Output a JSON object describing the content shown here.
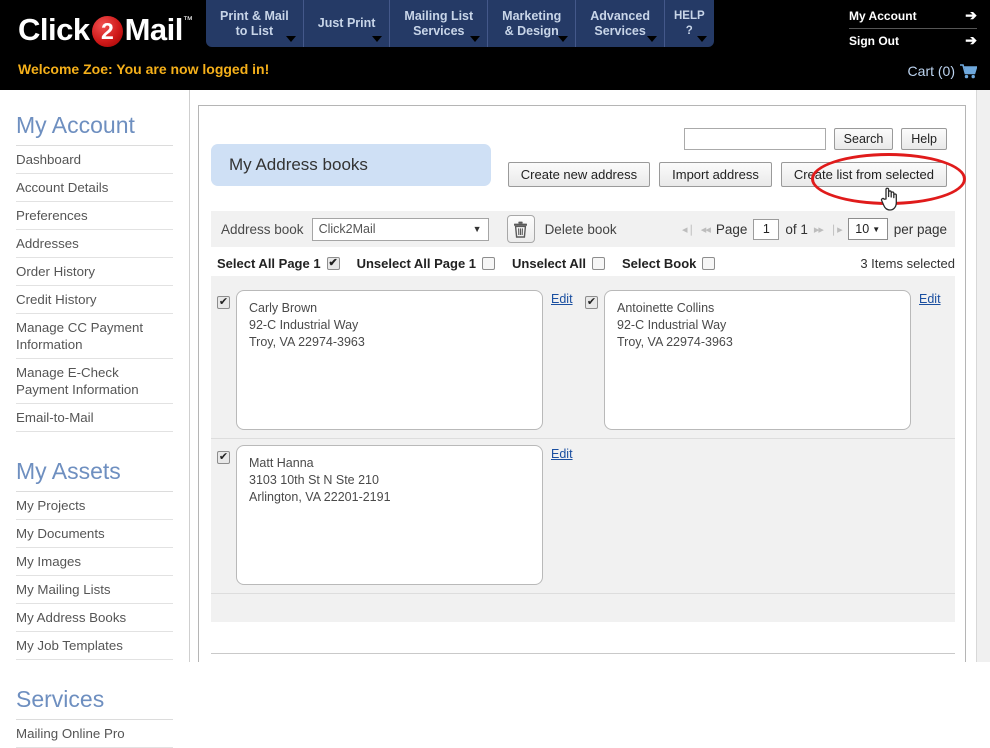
{
  "brand": {
    "name_part1": "Click",
    "name_badge": "2",
    "name_part2": "Mail",
    "trademark": "™",
    "accent_red": "#d01a1a",
    "nav_blue": "#253a66"
  },
  "topbar": {
    "welcome": "Welcome Zoe: You are now logged in!",
    "cart_label": "Cart (0)",
    "cart_icon": "shopping-cart-icon",
    "account_links": [
      {
        "label": "My Account",
        "arrow": "➔"
      },
      {
        "label": "Sign Out",
        "arrow": "➔"
      }
    ]
  },
  "nav": {
    "items": [
      {
        "label": "Print & Mail\nto List",
        "has_caret": true
      },
      {
        "label": "Just Print",
        "has_caret": true
      },
      {
        "label": "Mailing List\nServices",
        "has_caret": true
      },
      {
        "label": "Marketing\n& Design",
        "has_caret": true
      },
      {
        "label": "Advanced\nServices",
        "has_caret": true
      },
      {
        "label": "HELP\n?",
        "has_caret": true
      }
    ]
  },
  "sidebar": {
    "groups": [
      {
        "heading": "My Account",
        "items": [
          "Dashboard",
          "Account Details",
          "Preferences",
          "Addresses",
          "Order History",
          "Credit History",
          "Manage CC Payment Information",
          "Manage E-Check Payment Information",
          "Email-to-Mail"
        ]
      },
      {
        "heading": "My Assets",
        "items": [
          "My Projects",
          "My Documents",
          "My Images",
          "My Mailing Lists",
          "My Address Books",
          "My Job Templates"
        ]
      },
      {
        "heading": "Services",
        "items": [
          "Mailing Online Pro"
        ]
      }
    ]
  },
  "main": {
    "page_title": "My Address books",
    "search": {
      "value": "",
      "placeholder": "",
      "search_button": "Search",
      "help_button": "Help"
    },
    "actions": [
      "Create new address",
      "Import address",
      "Create list from selected"
    ],
    "highlighted_action": "Create list from selected",
    "controls": {
      "address_book_label": "Address book",
      "address_book_value": "Click2Mail",
      "delete_icon": "trash-icon",
      "delete_label": "Delete book",
      "pager": {
        "first_icon": "◂❘",
        "prev_icon": "◂◂",
        "page_label": "Page",
        "page_value": "1",
        "of_label": "of 1",
        "next_icon": "▸▸",
        "last_icon": "❘▸",
        "per_page_value": "10",
        "per_page_label": "per page"
      }
    },
    "selection_row": {
      "options": [
        {
          "label": "Select All Page 1",
          "checked": true
        },
        {
          "label": "Unselect All Page 1",
          "checked": false
        },
        {
          "label": "Unselect All",
          "checked": false
        },
        {
          "label": "Select Book",
          "checked": false
        }
      ],
      "count_text": "3 Items selected"
    },
    "edit_link_label": "Edit",
    "address_rows": [
      [
        {
          "checked": true,
          "name": "Carly Brown",
          "street": "92-C Industrial Way",
          "citystatezip": "Troy, VA 22974-3963"
        },
        {
          "checked": true,
          "name": "Antoinette Collins",
          "street": "92-C Industrial Way",
          "citystatezip": "Troy, VA 22974-3963"
        }
      ],
      [
        {
          "checked": true,
          "name": "Matt Hanna",
          "street": "3103 10th St N Ste 210",
          "citystatezip": "Arlington, VA 22201-2191"
        }
      ]
    ]
  }
}
